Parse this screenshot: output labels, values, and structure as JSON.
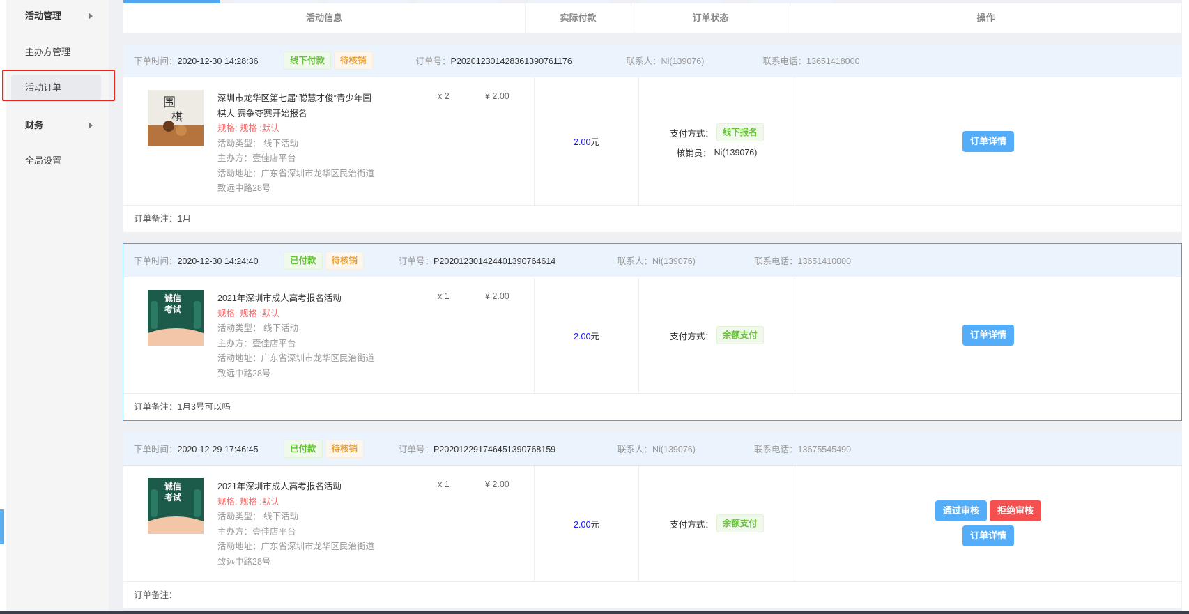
{
  "sidebar": {
    "items": [
      {
        "label": "活动管理"
      },
      {
        "label": "主办方管理"
      },
      {
        "label": "活动订单"
      },
      {
        "label": "财务"
      },
      {
        "label": "全局设置"
      }
    ]
  },
  "table": {
    "headers": [
      "活动信息",
      "实际付款",
      "订单状态",
      "操作"
    ]
  },
  "labels": {
    "time": "下单时间：",
    "order_no": "订单号：",
    "contact": "联系人：",
    "phone": "联系电话：",
    "pay_method": "支付方式：",
    "verifier": "核销员：",
    "remark": "订单备注：",
    "type": "活动类型：",
    "host": "主办方：",
    "address": "活动地址："
  },
  "buttons": {
    "detail": "订单详情",
    "approve": "通过审核",
    "reject": "拒绝审核"
  },
  "orders": [
    {
      "time": "2020-12-30 14:28:36",
      "pay_tag": "线下付款",
      "status_tag": "待核销",
      "order_no": "P202012301428361390761176",
      "contact": "Ni(139076)",
      "phone": "13651418000",
      "title": "深圳市龙华区第七届“聪慧才俊”青少年围棋大 赛争夺赛开始报名",
      "spec": "规格: 规格 :默认",
      "type": "线下活动",
      "host": "壹佳店平台",
      "address": "广东省深圳市龙华区民治街道致远中路28号",
      "qty": "x 2",
      "price": "¥  2.00",
      "amount": "2.00",
      "unit": "元",
      "pay_method": "线下报名",
      "verifier": "Ni(139076)",
      "remark": "1月"
    },
    {
      "time": "2020-12-30 14:24:40",
      "pay_tag": "已付款",
      "status_tag": "待核销",
      "order_no": "P202012301424401390764614",
      "contact": "Ni(139076)",
      "phone": "13651410000",
      "title": "2021年深圳市成人高考报名活动",
      "spec": "规格: 规格 :默认",
      "type": "线下活动",
      "host": "壹佳店平台",
      "address": "广东省深圳市龙华区民治街道致远中路28号",
      "qty": "x 1",
      "price": "¥  2.00",
      "amount": "2.00",
      "unit": "元",
      "pay_method": "余额支付",
      "remark": "1月3号可以吗"
    },
    {
      "time": "2020-12-29 17:46:45",
      "pay_tag": "已付款",
      "status_tag": "待核销",
      "order_no": "P202012291746451390768159",
      "contact": "Ni(139076)",
      "phone": "13675545490",
      "title": "2021年深圳市成人高考报名活动",
      "spec": "规格: 规格 :默认",
      "type": "线下活动",
      "host": "壹佳店平台",
      "address": "广东省深圳市龙华区民治街道致远中路28号",
      "qty": "x 1",
      "price": "¥  2.00",
      "amount": "2.00",
      "unit": "元",
      "pay_method": "余额支付",
      "remark": ""
    }
  ]
}
